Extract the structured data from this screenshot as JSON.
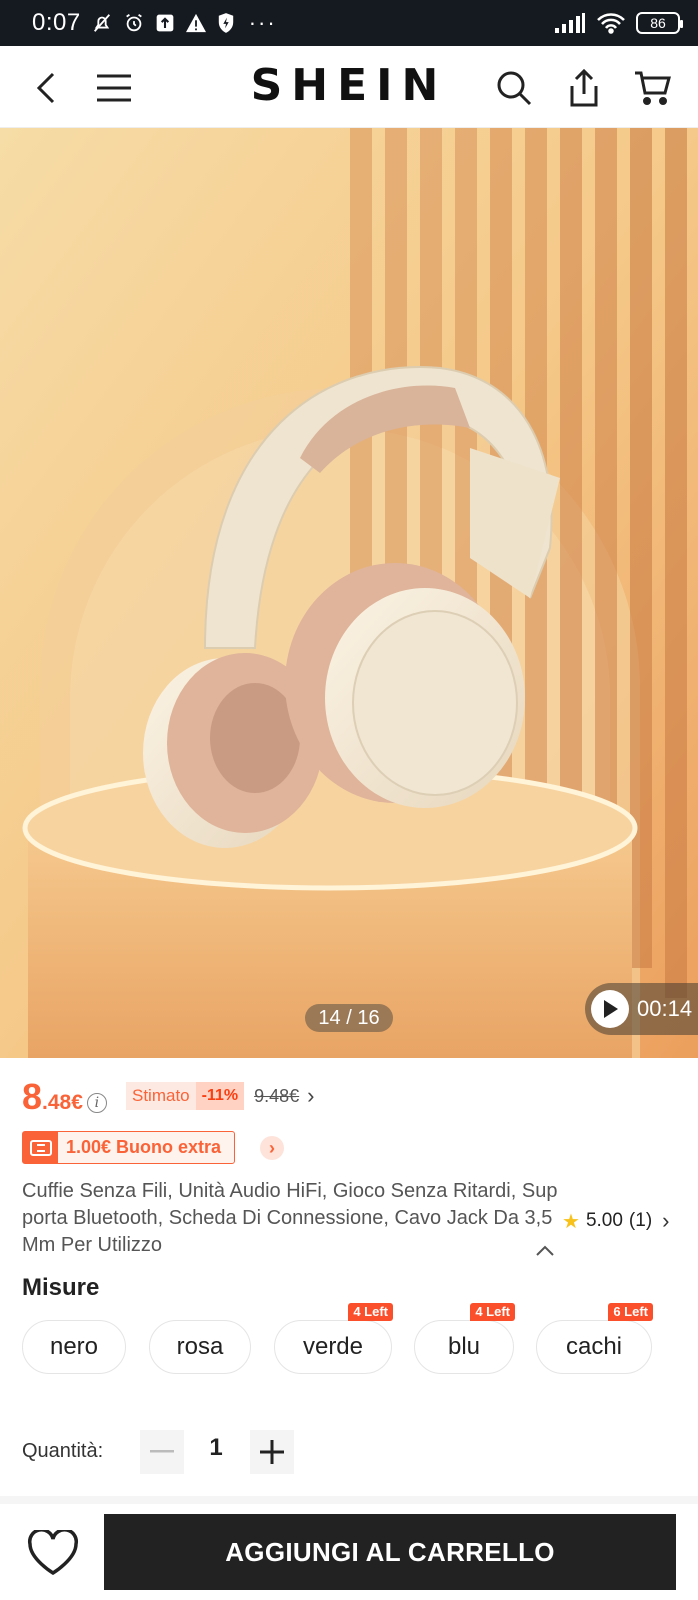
{
  "status_bar": {
    "time": "0:07",
    "battery": "86"
  },
  "header": {
    "logo": "SHEIN"
  },
  "gallery": {
    "counter": "14 / 16",
    "video_duration": "00:14"
  },
  "price": {
    "integer": "8",
    "decimal": ".48€",
    "estimate_label": "Stimato",
    "discount": "-11%",
    "original": "9.48€"
  },
  "coupon": {
    "text": "1.00€ Buono extra"
  },
  "product": {
    "title": "Cuffie Senza Fili, Unità Audio HiFi, Gioco Senza Ritardi, Supporta Bluetooth, Scheda Di Connessione, Cavo Jack Da 3,5 Mm Per Utilizzo",
    "rating": "5.00",
    "reviews": "(1)"
  },
  "options": {
    "label": "Misure",
    "items": [
      {
        "name": "nero",
        "badge": ""
      },
      {
        "name": "rosa",
        "badge": ""
      },
      {
        "name": "verde",
        "badge": "4 Left"
      },
      {
        "name": "blu",
        "badge": "4 Left"
      },
      {
        "name": "cachi",
        "badge": "6 Left"
      }
    ]
  },
  "quantity": {
    "label": "Quantità:",
    "value": "1"
  },
  "footer": {
    "add_to_cart": "AGGIUNGI AL CARRELLO"
  },
  "colors": {
    "accent": "#fa6338",
    "dark": "#222222",
    "star": "#f8c21b"
  }
}
